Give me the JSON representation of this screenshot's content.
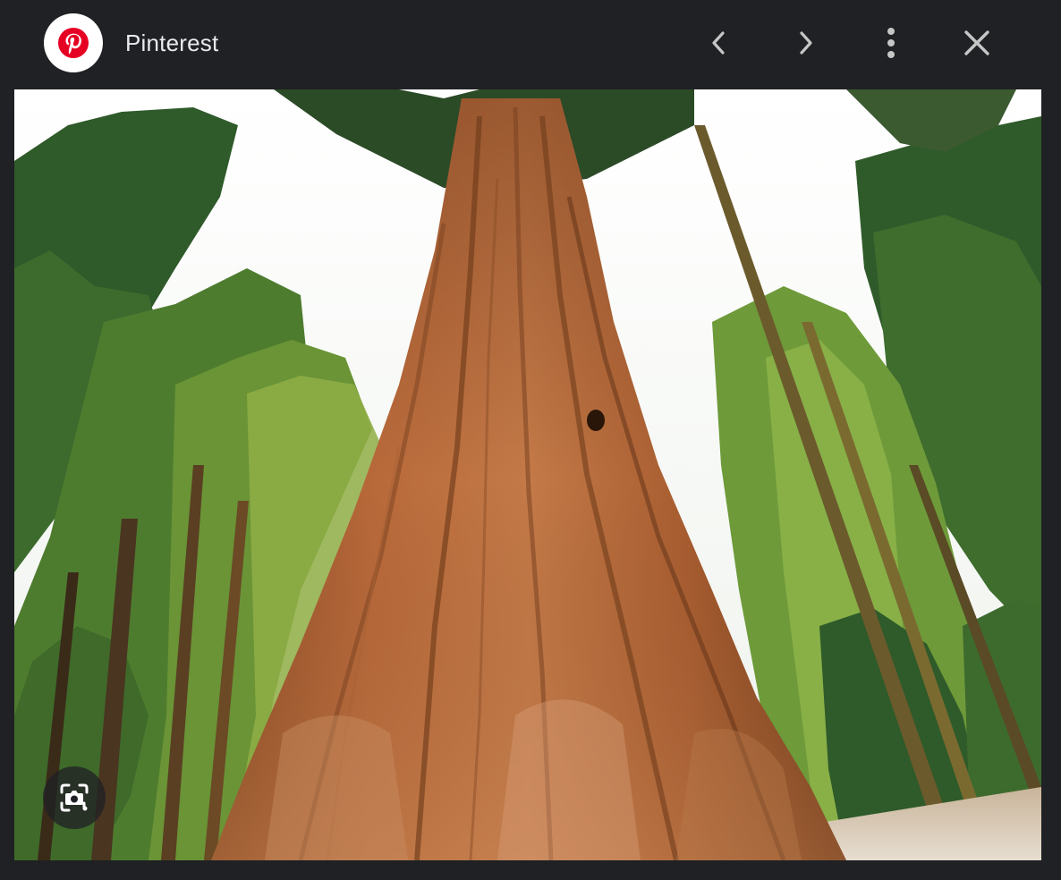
{
  "header": {
    "source_name": "Pinterest",
    "source_logo_icon": "pinterest-logo",
    "brand_color": "#e60023",
    "controls": {
      "prev_icon": "chevron-left-icon",
      "next_icon": "chevron-right-icon",
      "more_icon": "more-vert-icon",
      "close_icon": "close-icon"
    }
  },
  "image": {
    "lens_icon": "lens-search-icon"
  },
  "colors": {
    "background": "#1f2124",
    "text": "#e8eaed",
    "icon": "#c4c7c5"
  }
}
